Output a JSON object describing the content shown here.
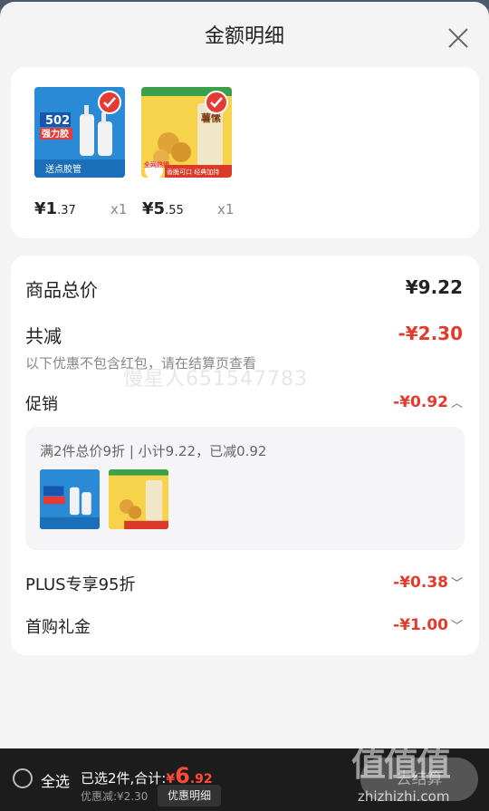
{
  "header": {
    "title": "金额明细"
  },
  "products": [
    {
      "price_int": "¥1",
      "price_dec": ".37",
      "qty": "x1",
      "label_top": "502",
      "label_mid": "强力胶",
      "label_bottom": "送点胶管"
    },
    {
      "price_int": "¥5",
      "price_dec": ".55",
      "qty": "x1",
      "label_top": "薯愫",
      "label_mid": "全网热销",
      "label_bottom": "香脆可口 经典加持"
    }
  ],
  "summary": {
    "total_label": "商品总价",
    "total_value": "¥9.22",
    "reduce_label": "共减",
    "reduce_value": "-¥2.30",
    "note": "以下优惠不包含红包，请在结算页查看",
    "watermark": "慢星人651547783",
    "promo_label": "促销",
    "promo_value": "-¥0.92",
    "promo_detail": "满2件总价9折 | 小计9.22，已减0.92",
    "plus_label": "PLUS专享95折",
    "plus_value": "-¥0.38",
    "gift_label": "首购礼金",
    "gift_value": "-¥1.00"
  },
  "bottom": {
    "select_all": "全选",
    "selected_text": "已选2件,合计:",
    "total_currency": "¥",
    "total_int": "6",
    "total_dec": ".92",
    "discount_line": "优惠减:¥2.30",
    "detail_button": "优惠明细",
    "checkout_button": "去结算"
  },
  "corner": {
    "mark": "值值值",
    "url": "zhizhizhi.com"
  },
  "colors": {
    "accent_red": "#e33a2c",
    "sheet_bg": "#f4f4f4",
    "bar_bg": "#1c1c1c"
  }
}
